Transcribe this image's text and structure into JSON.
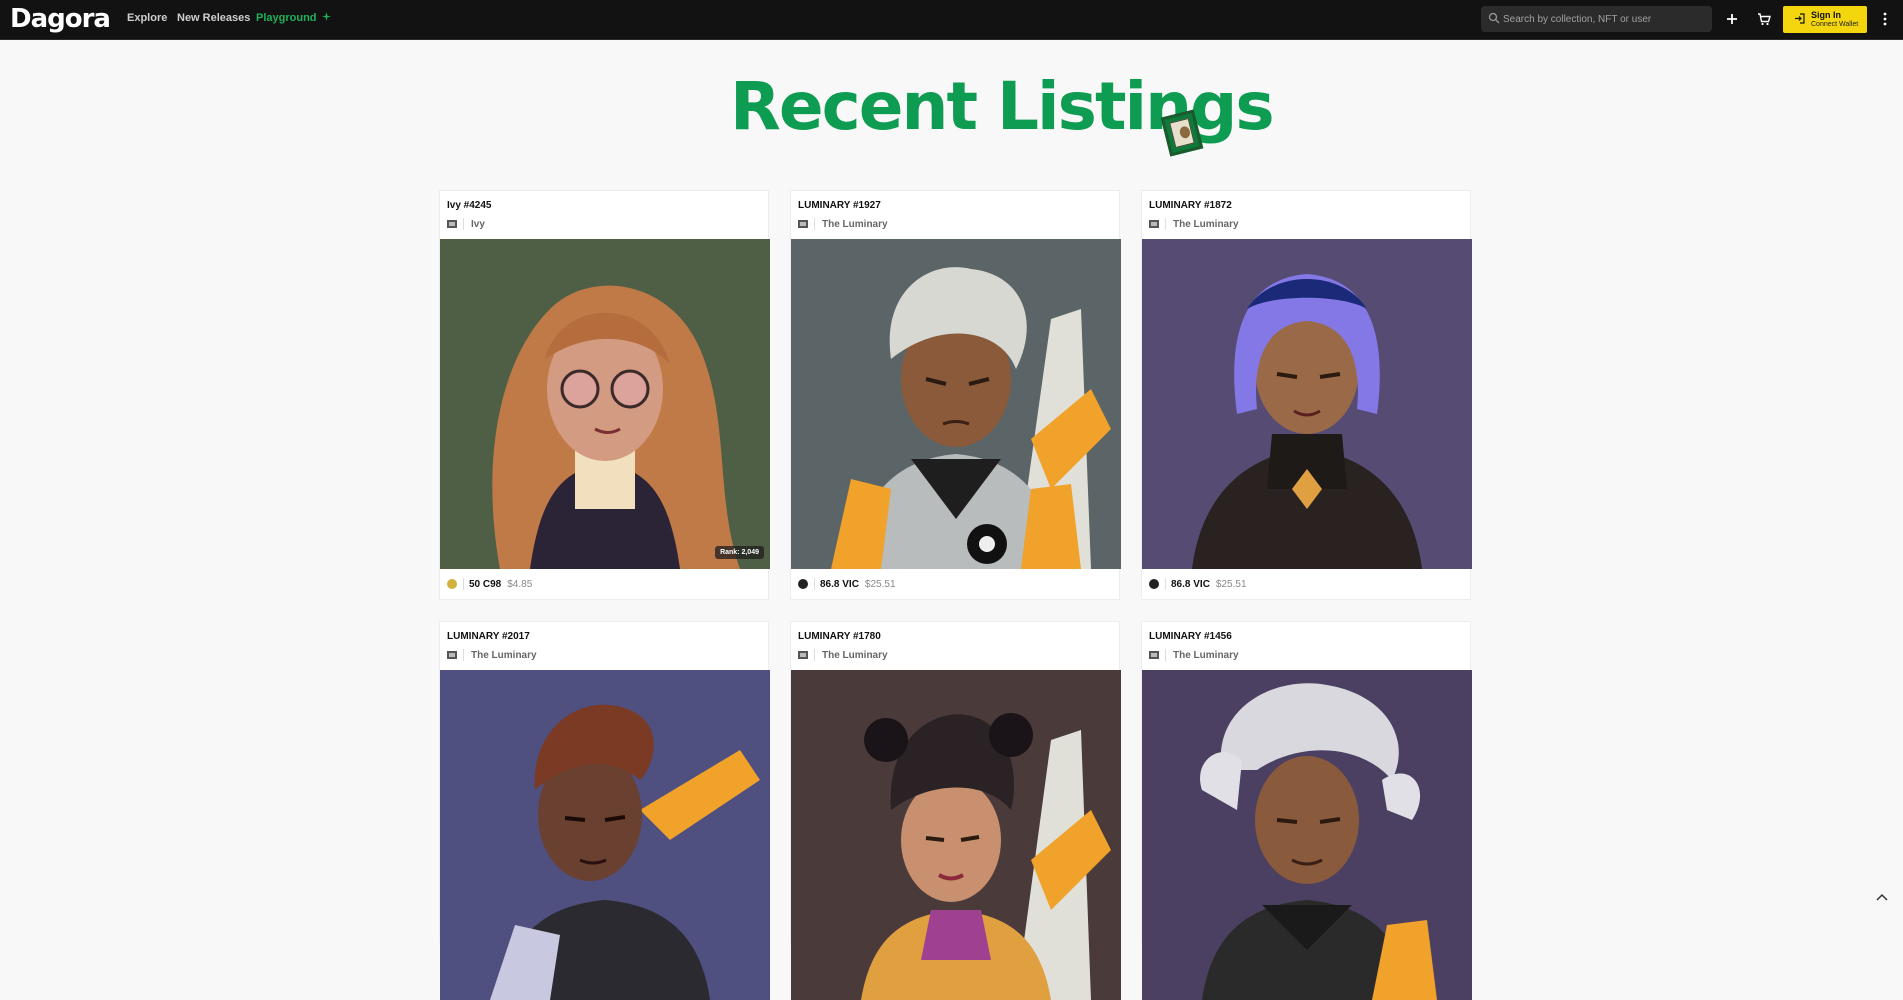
{
  "header": {
    "logo": "Dagora",
    "nav": {
      "explore": "Explore",
      "new_releases": "New Releases",
      "playground": "Playground"
    },
    "search_placeholder": "Search by collection, NFT or user",
    "signin_label": "Sign In",
    "signin_sub": "Connect Wallet"
  },
  "page": {
    "title": "Recent Listings"
  },
  "listings": [
    {
      "title": "Ivy #4245",
      "collection": "Ivy",
      "price": "50 C98",
      "usd": "$4.85",
      "rank": "Rank: 2,049",
      "bg": "#4f5f46",
      "coin": "#d2b23c"
    },
    {
      "title": "LUMINARY #1927",
      "collection": "The Luminary",
      "price": "86.8 VIC",
      "usd": "$25.51",
      "bg": "#5b6466",
      "coin": "#222222"
    },
    {
      "title": "LUMINARY #1872",
      "collection": "The Luminary",
      "price": "86.8 VIC",
      "usd": "$25.51",
      "bg": "#564c73",
      "coin": "#222222"
    },
    {
      "title": "LUMINARY #2017",
      "collection": "The Luminary",
      "bg": "#4f4f80",
      "coin": "#222222"
    },
    {
      "title": "LUMINARY #1780",
      "collection": "The Luminary",
      "bg": "#4a3a3a",
      "coin": "#222222"
    },
    {
      "title": "LUMINARY #1456",
      "collection": "The Luminary",
      "bg": "#4b4062",
      "coin": "#222222"
    }
  ],
  "icons": {
    "search": "search-icon",
    "add": "plus-icon",
    "cart": "cart-icon",
    "menu": "more-vertical-icon",
    "scroll": "chevron-up-icon"
  },
  "colors": {
    "accent_green": "#0e9b52",
    "signin_yellow": "#f3d60e",
    "topbar": "#121212"
  }
}
